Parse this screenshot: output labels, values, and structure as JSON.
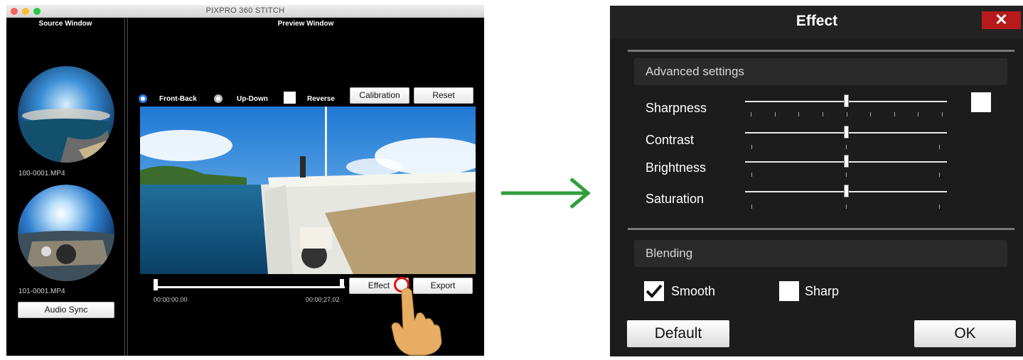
{
  "app": {
    "title": "PIXPRO 360 STITCH",
    "source_window_title": "Source Window",
    "preview_window_title": "Preview Window",
    "files": [
      "100-0001.MP4",
      "101-0001.MP4"
    ],
    "audio_sync_label": "Audio Sync",
    "mode_options": [
      "Front-Back",
      "Up-Down"
    ],
    "reverse_label": "Reverse",
    "calibration_label": "Calibration",
    "reset_label": "Reset",
    "time_start": "00:00:00.00",
    "time_end": "00:00:27.02",
    "effect_label": "Effect",
    "export_label": "Export"
  },
  "arrow_color": "#2f9e3a",
  "dialog": {
    "title": "Effect",
    "close_glyph": "✕",
    "advanced_title": "Advanced settings",
    "sliders": [
      {
        "label": "Sharpness",
        "value": 0.5
      },
      {
        "label": "Contrast",
        "value": 0.5
      },
      {
        "label": "Brightness",
        "value": 0.5
      },
      {
        "label": "Saturation",
        "value": 0.5
      }
    ],
    "blending_title": "Blending",
    "smooth_label": "Smooth",
    "smooth_checked": true,
    "sharp_label": "Sharp",
    "sharp_checked": false,
    "default_label": "Default",
    "ok_label": "OK",
    "close_color": "#b8191b"
  }
}
